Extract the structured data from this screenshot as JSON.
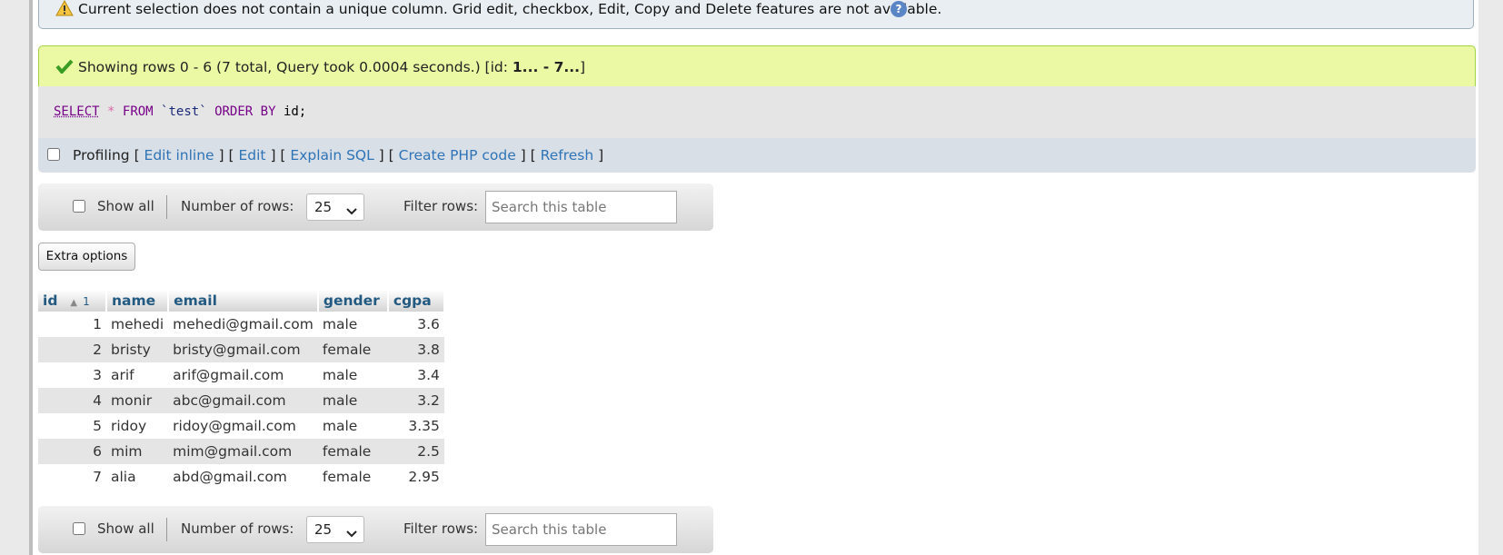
{
  "warning": {
    "text": "Current selection does not contain a unique column. Grid edit, checkbox, Edit, Copy and Delete features are not available.",
    "help_icon": "?"
  },
  "success": {
    "text_prefix": "Showing rows 0 - 6 (7 total, Query took 0.0004 seconds.) [id: ",
    "text_bold": "1... - 7...",
    "text_suffix": "]"
  },
  "sql": {
    "select": "SELECT",
    "star": "*",
    "from": "FROM",
    "table": "`test`",
    "order_by": "ORDER BY",
    "column": "id;"
  },
  "profiling": {
    "label": "Profiling",
    "links": [
      "Edit inline",
      "Edit",
      "Explain SQL",
      "Create PHP code",
      "Refresh"
    ]
  },
  "nav": {
    "show_all": "Show all",
    "number_of_rows_label": "Number of rows:",
    "number_of_rows_value": "25",
    "filter_label": "Filter rows:",
    "search_placeholder": "Search this table"
  },
  "extra_options": "Extra options",
  "table": {
    "columns": [
      "id",
      "name",
      "email",
      "gender",
      "cgpa"
    ],
    "sort_index": "1",
    "rows": [
      {
        "id": "1",
        "name": "mehedi",
        "email": "mehedi@gmail.com",
        "gender": "male",
        "cgpa": "3.6"
      },
      {
        "id": "2",
        "name": "bristy",
        "email": "bristy@gmail.com",
        "gender": "female",
        "cgpa": "3.8"
      },
      {
        "id": "3",
        "name": "arif",
        "email": "arif@gmail.com",
        "gender": "male",
        "cgpa": "3.4"
      },
      {
        "id": "4",
        "name": "monir",
        "email": "abc@gmail.com",
        "gender": "male",
        "cgpa": "3.2"
      },
      {
        "id": "5",
        "name": "ridoy",
        "email": "ridoy@gmail.com",
        "gender": "male",
        "cgpa": "3.35"
      },
      {
        "id": "6",
        "name": "mim",
        "email": "mim@gmail.com",
        "gender": "female",
        "cgpa": "2.5"
      },
      {
        "id": "7",
        "name": "alia",
        "email": "abd@gmail.com",
        "gender": "female",
        "cgpa": "2.95"
      }
    ]
  },
  "colors": {
    "link": "#2e74b6",
    "header_text": "#235a81",
    "success_bg": "#ebf8a4",
    "warning_bg": "#e8eef1"
  }
}
